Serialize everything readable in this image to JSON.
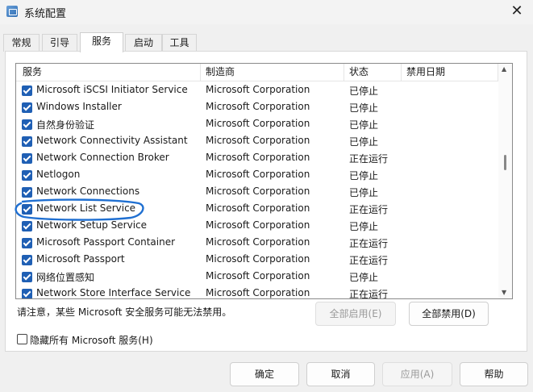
{
  "window": {
    "title": "系统配置",
    "close_glyph": "✕"
  },
  "tabs": [
    {
      "label": "常规"
    },
    {
      "label": "引导"
    },
    {
      "label": "服务",
      "active": true
    },
    {
      "label": "启动"
    },
    {
      "label": "工具"
    }
  ],
  "columns": {
    "service": "服务",
    "vendor": "制造商",
    "status": "状态",
    "disabled_date": "禁用日期"
  },
  "rows": [
    {
      "name": "Microsoft iSCSI Initiator Service",
      "vendor": "Microsoft Corporation",
      "status": "已停止",
      "checked": true
    },
    {
      "name": "Windows Installer",
      "vendor": "Microsoft Corporation",
      "status": "已停止",
      "checked": true
    },
    {
      "name": "自然身份验证",
      "vendor": "Microsoft Corporation",
      "status": "已停止",
      "checked": true
    },
    {
      "name": "Network Connectivity Assistant",
      "vendor": "Microsoft Corporation",
      "status": "已停止",
      "checked": true
    },
    {
      "name": "Network Connection Broker",
      "vendor": "Microsoft Corporation",
      "status": "正在运行",
      "checked": true
    },
    {
      "name": "Netlogon",
      "vendor": "Microsoft Corporation",
      "status": "已停止",
      "checked": true
    },
    {
      "name": "Network Connections",
      "vendor": "Microsoft Corporation",
      "status": "已停止",
      "checked": true
    },
    {
      "name": "Network List Service",
      "vendor": "Microsoft Corporation",
      "status": "正在运行",
      "checked": true
    },
    {
      "name": "Network Setup Service",
      "vendor": "Microsoft Corporation",
      "status": "已停止",
      "checked": true
    },
    {
      "name": "Microsoft Passport Container",
      "vendor": "Microsoft Corporation",
      "status": "正在运行",
      "checked": true
    },
    {
      "name": "Microsoft Passport",
      "vendor": "Microsoft Corporation",
      "status": "正在运行",
      "checked": true
    },
    {
      "name": "网络位置感知",
      "vendor": "Microsoft Corporation",
      "status": "已停止",
      "checked": true
    },
    {
      "name": "Network Store Interface Service",
      "vendor": "Microsoft Corporation",
      "status": "正在运行",
      "checked": true
    }
  ],
  "note": "请注意，某些 Microsoft 安全服务可能无法禁用。",
  "buttons": {
    "enable_all": "全部启用(E)",
    "disable_all": "全部禁用(D)",
    "ok": "确定",
    "cancel": "取消",
    "apply": "应用(A)",
    "help": "帮助"
  },
  "hide_ms_label": "隐藏所有 Microsoft 服务(H)",
  "colors": {
    "checkbox": "#1f5fb4",
    "annotation": "#1f6fd1"
  }
}
